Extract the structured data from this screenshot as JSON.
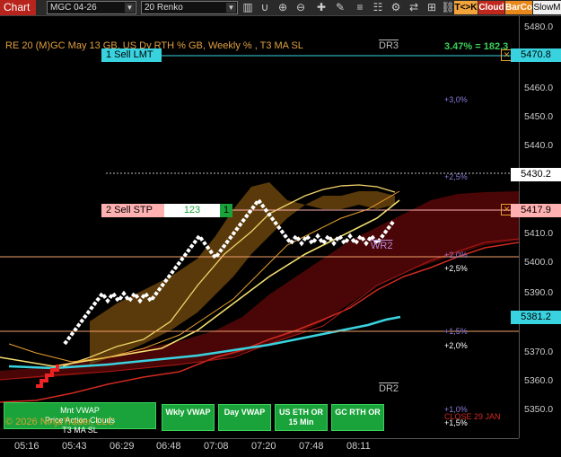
{
  "toolbar": {
    "chart_label": "Chart",
    "instrument": "MGC 04-26",
    "bar_type": "20 Renko",
    "tk_label": "T<>K",
    "cloud_label": "Cloud",
    "barco_label": "BarCo",
    "slow_label": "SlowM"
  },
  "chart": {
    "title": "RE 20  (M)GC May 13 GB, US Dy RTH % GB, Weekly % , T3 MA SL",
    "performance": "3.47% = 182.3",
    "dr3": "DR3",
    "dr2": "DR2",
    "wr2": "WR2",
    "copyright": "© 2026 NinjaTrader, LLC",
    "close_label": "CLOSE 29 JAN",
    "pct_labels": [
      "+3,0%",
      "+2,5%",
      "+2,0%",
      "+2,5%",
      "+1,5%",
      "+2,0%",
      "+1,0%",
      "+1,5%"
    ]
  },
  "orders": {
    "sell_lmt": "1 Sell LMT",
    "sell_stp": "2 Sell STP",
    "qty": "123",
    "count": "1"
  },
  "price_tags": {
    "upper": "5470.8",
    "last": "5430.2",
    "stop": "5417.9",
    "ma": "5381.2"
  },
  "y_axis": [
    "5480.0",
    "5470.0",
    "5460.0",
    "5450.0",
    "5440.0",
    "5430.0",
    "5420.0",
    "5410.0",
    "5400.0",
    "5390.0",
    "5380.0",
    "5370.0",
    "5360.0",
    "5350.0"
  ],
  "x_axis": [
    "05:16",
    "05:43",
    "06:29",
    "06:48",
    "07:08",
    "07:20",
    "07:48",
    "08:11"
  ],
  "buttons": {
    "mnt_vwap": "Mnt VWAP",
    "price_action": "Price Action Clouds",
    "t3": "T3 MA SL",
    "wkly_vwap": "Wkly VWAP",
    "day_vwap": "Day VWAP",
    "us_eth": "US ETH OR 15 Min",
    "gc_rth": "GC RTH OR"
  },
  "colors": {
    "accent_red": "#b7241c",
    "cyan": "#39d3e0",
    "green": "#1aa33a",
    "orange": "#ff9a1a"
  }
}
